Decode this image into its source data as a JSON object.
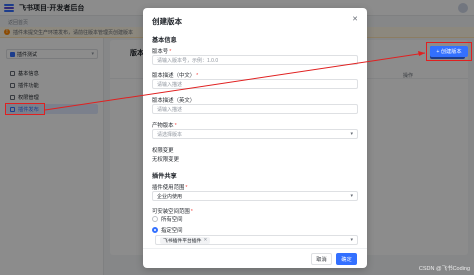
{
  "app": {
    "title": "飞书项目·开发者后台",
    "return_link": "返回首页",
    "notice": "插件未提交生产环境发布，请前往版本管理页创建版本"
  },
  "sidebar": {
    "plugin_name": "插件测试",
    "items": [
      {
        "label": "基本信息",
        "icon": "info-icon",
        "active": false
      },
      {
        "label": "插件功能",
        "icon": "puzzle-icon",
        "active": false
      },
      {
        "label": "权限管理",
        "icon": "lock-icon",
        "active": false
      },
      {
        "label": "插件发布",
        "icon": "publish-icon",
        "active": true
      }
    ]
  },
  "main": {
    "title": "版本管理",
    "create_button": "+ 创建版本",
    "column_header": "操作"
  },
  "modal": {
    "title": "创建版本",
    "section_basic": "基本信息",
    "version_label": "版本号",
    "version_placeholder": "请输入版本号，示例：1.0.0",
    "desc_zh_label": "版本描述（中文）",
    "desc_zh_placeholder": "请输入描述",
    "desc_en_label": "版本描述（英文）",
    "desc_en_placeholder": "请输入描述",
    "prod_version_label": "产物版本",
    "prod_version_placeholder": "请选择版本",
    "perm_change_label": "权限变更",
    "perm_change_value": "无权限变更",
    "section_share": "插件共享",
    "scope_label": "插件使用范围",
    "scope_value": "企业内使用",
    "space_label": "可安装空间范围",
    "radio_all": "所有空间",
    "radio_specified": "指定空间",
    "space_tag": "飞书插件平台插件",
    "cancel": "取消",
    "confirm": "确定"
  },
  "watermark": "CSDN @飞书Coding",
  "colors": {
    "accent": "#3370ff",
    "annotation": "#e02020"
  }
}
